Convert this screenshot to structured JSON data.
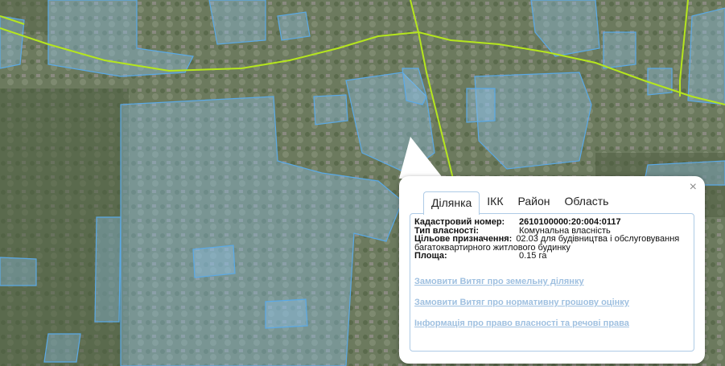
{
  "popup": {
    "close_label": "×",
    "tabs": [
      {
        "label": "Ділянка",
        "active": true
      },
      {
        "label": "ІКК",
        "active": false
      },
      {
        "label": "Район",
        "active": false
      },
      {
        "label": "Область",
        "active": false
      }
    ],
    "info": {
      "cadastral_label": "Кадастровий номер:",
      "cadastral_value": "2610100000:20:004:0117",
      "ownership_label": "Тип власності:",
      "ownership_value": "Комунальна власність",
      "purpose_label": "Цільове призначення:",
      "purpose_value": "02.03 для будівництва і обслуговування багатоквартирного житлового будинку",
      "area_label": "Площа:",
      "area_value": "0.15 га"
    },
    "links": [
      "Замовити Витяг про земельну ділянку",
      "Замовити Витяг про нормативну грошову оцінку",
      "Інформація про право власності та речові права"
    ]
  },
  "colors": {
    "parcel_fill": "#8fc3ea",
    "parcel_stroke": "#5aa9e6",
    "road_line": "#b5e61d",
    "link": "#9fc0e0",
    "tab_border": "#aecbe6"
  }
}
